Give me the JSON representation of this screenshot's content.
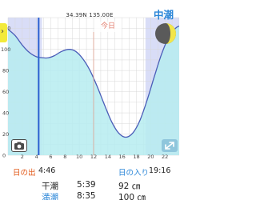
{
  "header": {
    "coordinates": "34.39N 135.00E",
    "tide_name": "中潮",
    "moon_icon": "moon-phase-icon",
    "menu_tab_icon": "chevron-right-icon"
  },
  "chart": {
    "today_label": "今日",
    "x_ticks": [
      "2",
      "4",
      "6",
      "8",
      "10",
      "12",
      "14",
      "16",
      "18",
      "20",
      "22"
    ],
    "y_ticks": [
      "120",
      "100",
      "80",
      "60",
      "40",
      "20",
      "0"
    ],
    "camera_icon": "camera-icon",
    "expand_icon": "expand-icon",
    "colors": {
      "tide_fill": "#b6ecf0",
      "tide_line": "#4a5db8",
      "night_shade": "#d9ddf7",
      "current_line": "#2a5fd0",
      "today_line": "#e0a090",
      "grid": "#d8d8d8"
    }
  },
  "chart_data": {
    "type": "area",
    "x_range": [
      0,
      24
    ],
    "y_range": [
      0,
      130
    ],
    "sunrise_hour": 4.77,
    "sunset_hour": 19.27,
    "current_hour": 4.3,
    "series": [
      {
        "x": [
          0,
          1,
          2,
          3,
          4,
          5,
          5.65,
          6.5,
          7.5,
          8.58,
          9.5,
          10.5,
          11.5,
          12.5,
          13.5,
          14.5,
          15.5,
          16.5,
          17.5,
          18.5,
          19.5,
          20.5,
          21.5,
          22.5,
          23.5,
          24
        ],
        "y": [
          119,
          113,
          104,
          97,
          93,
          92,
          92,
          94,
          98,
          100,
          98,
          91,
          80,
          65,
          48,
          32,
          21,
          17,
          21,
          33,
          52,
          74,
          95,
          111,
          120,
          122
        ]
      }
    ]
  },
  "sun": {
    "sunrise_label": "日の出",
    "sunrise_time": "4:46",
    "sunset_label": "日の入り",
    "sunset_time": "19:16"
  },
  "tides": {
    "low_label": "干潮",
    "low_time": "5:39",
    "low_height": "92 ㎝",
    "high_label": "満潮",
    "high_time": "8:35",
    "high_height": "100 ㎝"
  }
}
